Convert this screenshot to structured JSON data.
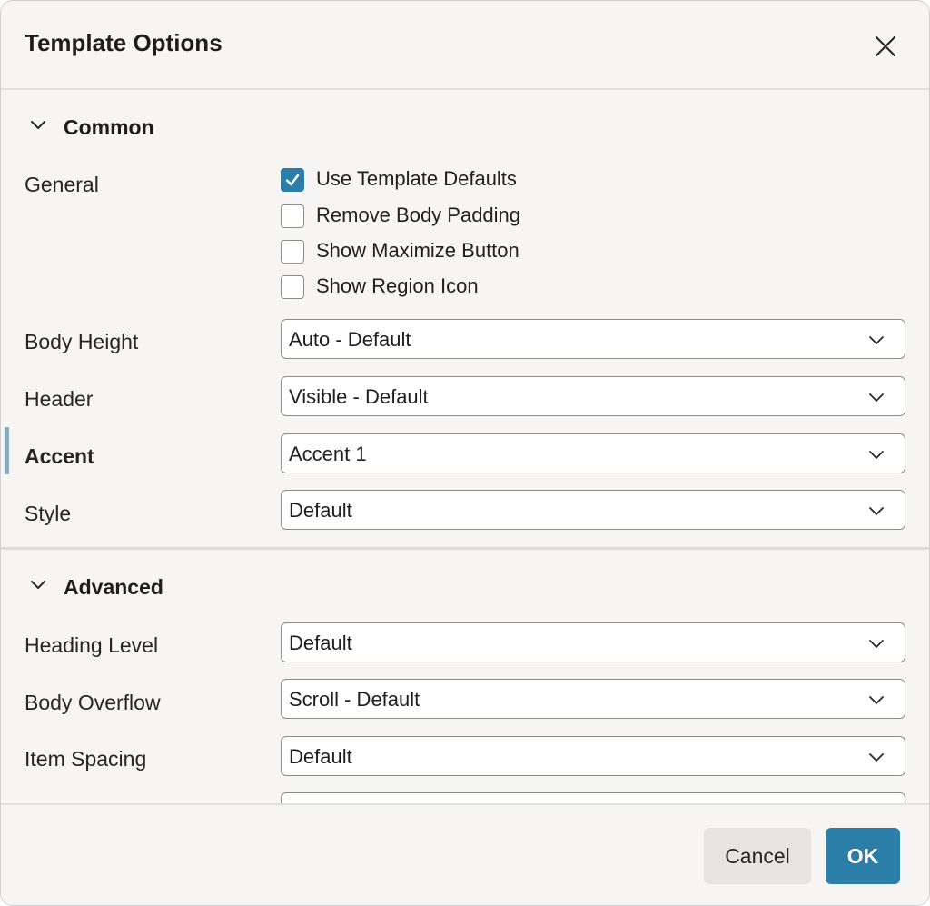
{
  "dialog": {
    "title": "Template Options",
    "close_icon": "close-icon"
  },
  "sections": {
    "common": {
      "label": "Common",
      "general": {
        "label": "General",
        "options": [
          {
            "label": "Use Template Defaults",
            "checked": true
          },
          {
            "label": "Remove Body Padding",
            "checked": false
          },
          {
            "label": "Show Maximize Button",
            "checked": false
          },
          {
            "label": "Show Region Icon",
            "checked": false
          }
        ]
      },
      "body_height": {
        "label": "Body Height",
        "value": "Auto - Default"
      },
      "header": {
        "label": "Header",
        "value": "Visible - Default"
      },
      "accent": {
        "label": "Accent",
        "value": "Accent 1"
      },
      "style": {
        "label": "Style",
        "value": "Default"
      }
    },
    "advanced": {
      "label": "Advanced",
      "heading_level": {
        "label": "Heading Level",
        "value": "Default"
      },
      "body_overflow": {
        "label": "Body Overflow",
        "value": "Scroll - Default"
      },
      "item_spacing": {
        "label": "Item Spacing",
        "value": "Default"
      },
      "next_field": {
        "value": ""
      }
    }
  },
  "footer": {
    "cancel_label": "Cancel",
    "ok_label": "OK"
  },
  "colors": {
    "primary": "#2a7ea8",
    "accent_marker": "#7fb0c8",
    "background": "#f6f5f3"
  }
}
